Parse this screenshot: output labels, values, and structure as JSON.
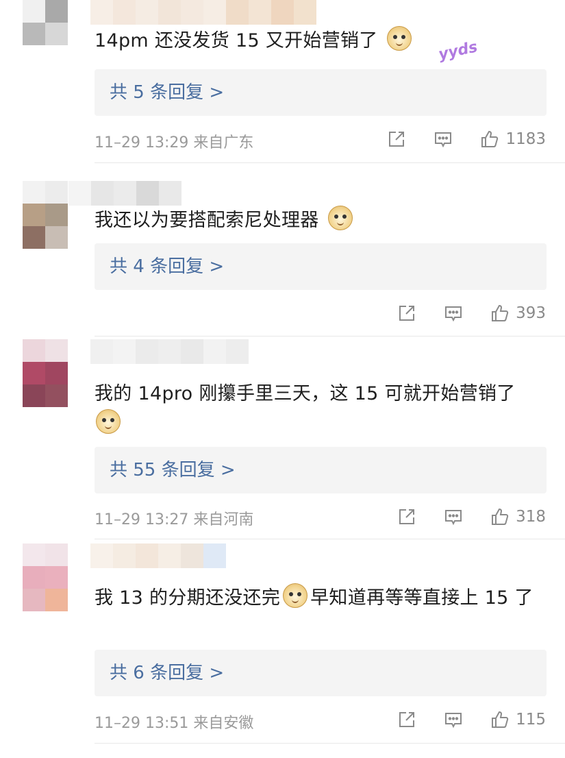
{
  "comments": [
    {
      "text_before": "14pm 还没发货 15 又开始营销了",
      "text_after": "",
      "badge": "yyds",
      "replies_label": "共 5 条回复 >",
      "meta": "11–29 13:29 来自广东",
      "likes": "1183"
    },
    {
      "text_before": "我还以为要搭配索尼处理器",
      "text_after": "",
      "replies_label": "共 4 条回复 >",
      "meta": "",
      "likes": "393"
    },
    {
      "text_before": "我的 14pro 刚攥手里三天，这 15 可就开始营销了",
      "text_after": "",
      "replies_label": "共 55 条回复 >",
      "meta": "11–29 13:27 来自河南",
      "likes": "318"
    },
    {
      "text_before": "我 13 的分期还没还完",
      "text_after": "早知道再等等直接上 15 了",
      "replies_label": "共 6 条回复 >",
      "meta": "11–29 13:51 来自安徽",
      "likes": "115"
    }
  ],
  "icons": {
    "share": "share-icon",
    "comment": "comment-icon",
    "like": "thumbs-up-icon",
    "emoji": "doge-emoji-icon"
  },
  "colors": {
    "reply_link": "#4a6ea0",
    "reply_bg": "#f4f4f4",
    "meta": "#9a9a9a"
  }
}
